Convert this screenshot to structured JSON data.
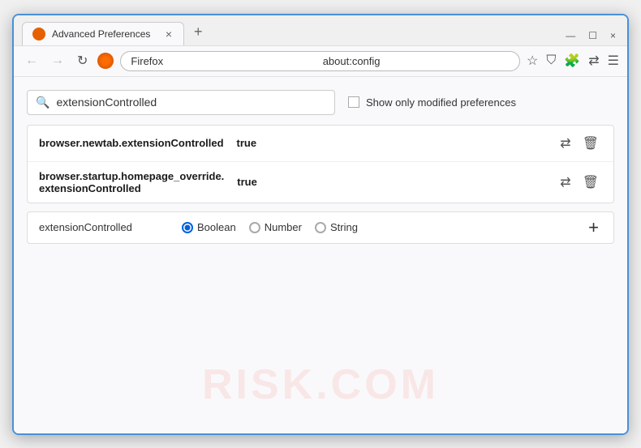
{
  "window": {
    "title": "Advanced Preferences",
    "tab_close": "×",
    "tab_new": "+",
    "controls": {
      "minimize": "—",
      "maximize": "☐",
      "close": "×"
    }
  },
  "navbar": {
    "back_label": "←",
    "forward_label": "→",
    "refresh_label": "↻",
    "browser_name": "Firefox",
    "address": "about:config",
    "icons": [
      "☆",
      "⛉",
      "🔖",
      "✉",
      "↺"
    ]
  },
  "search": {
    "placeholder": "",
    "value": "extensionControlled",
    "show_modified_label": "Show only modified preferences"
  },
  "results": [
    {
      "name": "browser.newtab.extensionControlled",
      "value": "true"
    },
    {
      "name": "browser.startup.homepage_override.\nextensionControlled",
      "name_line1": "browser.startup.homepage_override.",
      "name_line2": "extensionControlled",
      "value": "true",
      "multiline": true
    }
  ],
  "add_preference": {
    "name": "extensionControlled",
    "types": [
      {
        "id": "boolean",
        "label": "Boolean",
        "selected": true
      },
      {
        "id": "number",
        "label": "Number",
        "selected": false
      },
      {
        "id": "string",
        "label": "String",
        "selected": false
      }
    ],
    "add_btn_label": "+"
  },
  "watermark": "RISK.COM",
  "colors": {
    "accent": "#0060df",
    "border": "#4a90d9"
  }
}
